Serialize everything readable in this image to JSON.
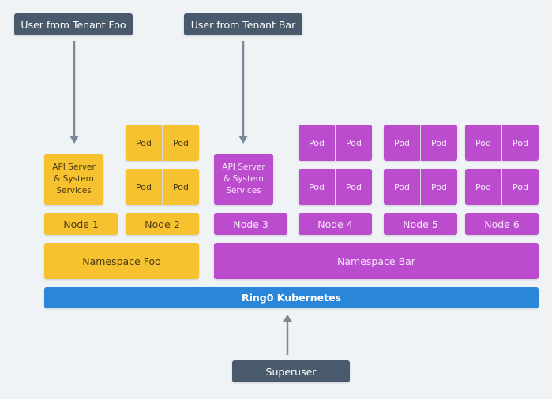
{
  "users": {
    "tenant_foo": "User from Tenant Foo",
    "tenant_bar": "User from Tenant Bar",
    "superuser": "Superuser"
  },
  "nodes": [
    {
      "label": "Node 1",
      "tenant": "Foo",
      "content": "API Server & System Services"
    },
    {
      "label": "Node 2",
      "tenant": "Foo",
      "pods": [
        "Pod",
        "Pod",
        "Pod",
        "Pod"
      ]
    },
    {
      "label": "Node 3",
      "tenant": "Bar",
      "content": "API Server & System Services"
    },
    {
      "label": "Node 4",
      "tenant": "Bar",
      "pods": [
        "Pod",
        "Pod",
        "Pod",
        "Pod"
      ]
    },
    {
      "label": "Node 5",
      "tenant": "Bar",
      "pods": [
        "Pod",
        "Pod",
        "Pod",
        "Pod"
      ]
    },
    {
      "label": "Node 6",
      "tenant": "Bar",
      "pods": [
        "Pod",
        "Pod",
        "Pod",
        "Pod"
      ]
    }
  ],
  "api_server": {
    "line1": "API Server",
    "line2": "& System",
    "line3": "Services"
  },
  "pod_label": "Pod",
  "namespaces": {
    "foo": "Namespace Foo",
    "bar": "Namespace Bar"
  },
  "cluster": "Ring0 Kubernetes",
  "colors": {
    "user_box": "#4a5a6d",
    "tenant_foo": "#f7c22f",
    "tenant_bar": "#bb4ccd",
    "cluster": "#2a86d9",
    "arrow": "#7a8898"
  }
}
